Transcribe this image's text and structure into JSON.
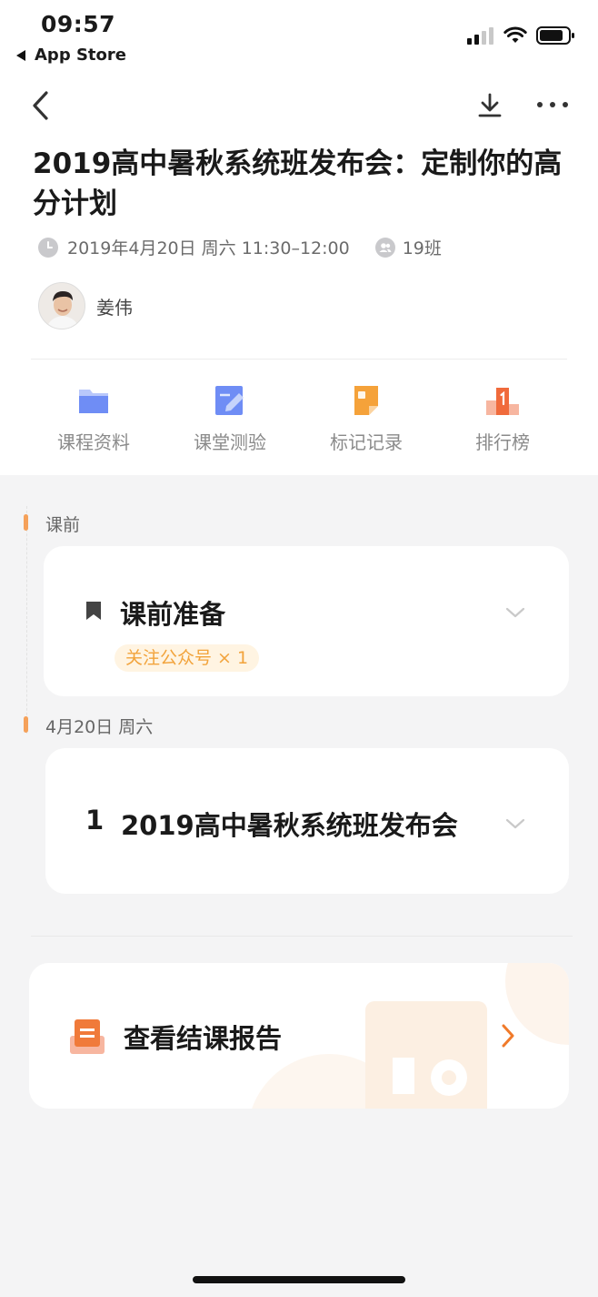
{
  "status_bar": {
    "time": "09:57",
    "back_app": "App Store"
  },
  "nav": {
    "back_icon": "chevron-left-icon",
    "download_icon": "download-icon",
    "more_icon": "more-icon"
  },
  "course": {
    "title": "2019高中暑秋系统班发布会：定制你的高分计划",
    "datetime": "2019年4月20日 周六 11:30–12:00",
    "class_count": "19班",
    "teacher": "姜伟"
  },
  "tools": [
    {
      "label": "课程资料",
      "icon": "folder-icon",
      "color": "#6f8df5"
    },
    {
      "label": "课堂测验",
      "icon": "quiz-icon",
      "color": "#6f8df5"
    },
    {
      "label": "标记记录",
      "icon": "bookmark-note-icon",
      "color": "#f5a23a"
    },
    {
      "label": "排行榜",
      "icon": "leaderboard-icon",
      "color": "#f06a3b"
    }
  ],
  "timeline": {
    "section1_label": "课前",
    "prep_card": {
      "title": "课前准备",
      "tag": "关注公众号 × 1"
    },
    "section2_label": "4月20日 周六",
    "lesson_card": {
      "index": "1",
      "title": "2019高中暑秋系统班发布会"
    }
  },
  "report": {
    "title": "查看结课报告"
  },
  "colors": {
    "accent": "#f5a15a",
    "tag_bg": "#fff4e2",
    "tag_text": "#f2a33b",
    "arrow": "#f07a2a"
  }
}
